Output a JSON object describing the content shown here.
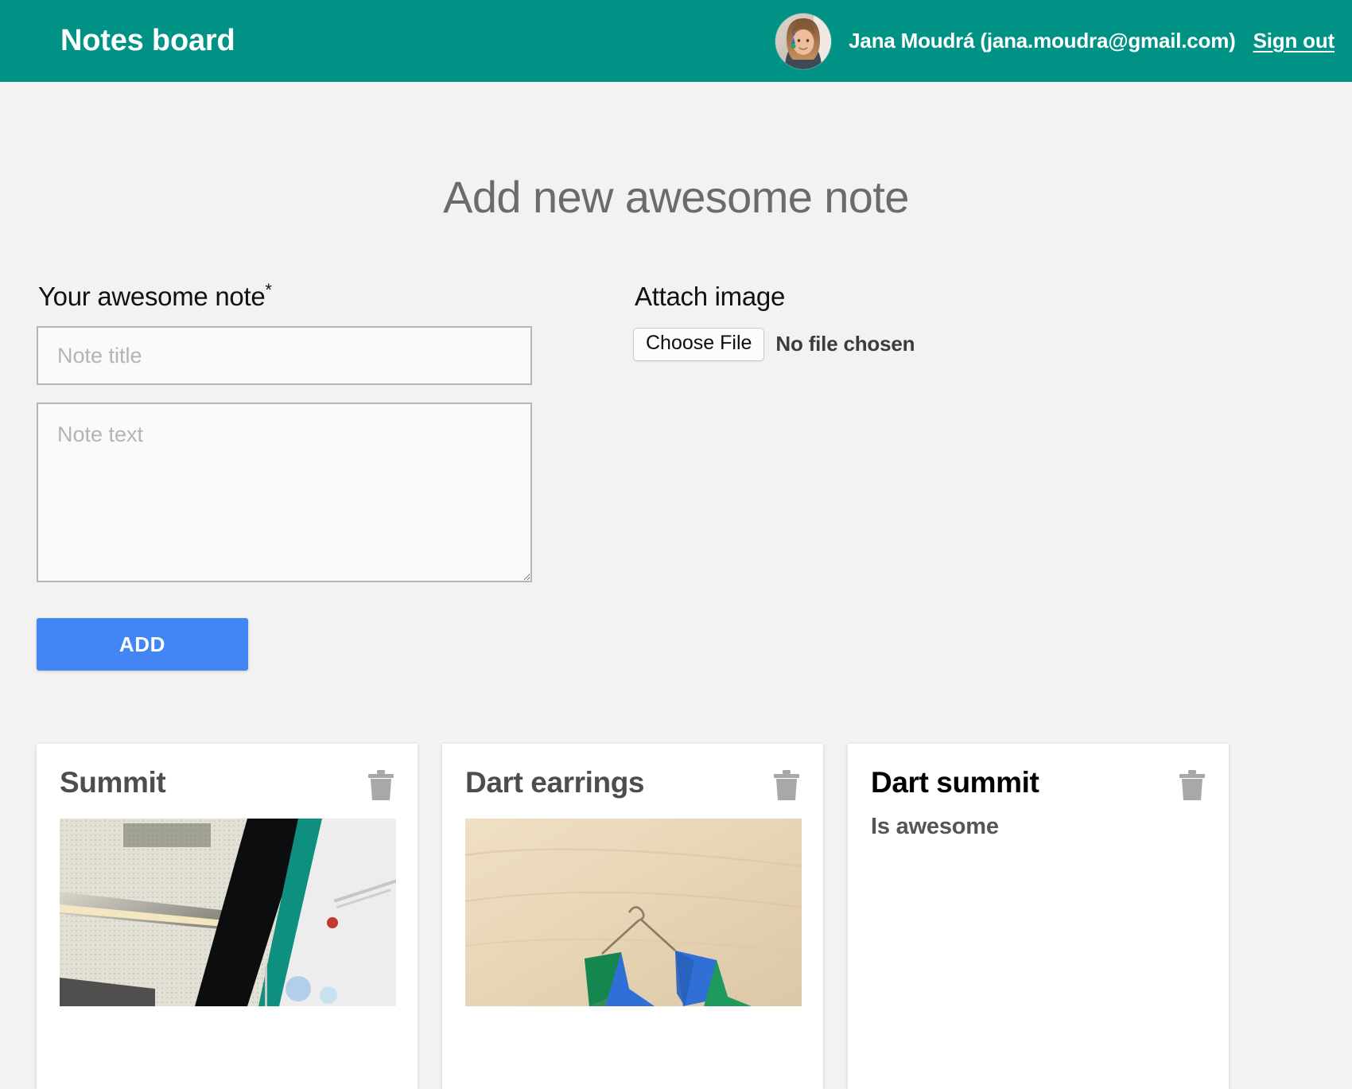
{
  "header": {
    "app_title": "Notes board",
    "user_label": "Jana Moudrá (jana.moudra@gmail.com)",
    "sign_out_label": "Sign out",
    "brand_color": "#009385"
  },
  "main": {
    "page_title": "Add new awesome note",
    "note_label": "Your awesome note",
    "required_marker": "*",
    "title_placeholder": "Note title",
    "title_value": "",
    "text_placeholder": "Note text",
    "text_value": "",
    "add_button_label": "ADD",
    "add_button_color": "#4285f4",
    "attach_label": "Attach image",
    "choose_file_label": "Choose File",
    "file_status": "No file chosen"
  },
  "cards": [
    {
      "title": "Summit",
      "body": "",
      "has_image": true,
      "delete_label": "Delete note"
    },
    {
      "title": "Dart earrings",
      "body": "",
      "has_image": true,
      "delete_label": "Delete note"
    },
    {
      "title": "Dart summit",
      "body": "Is awesome",
      "has_image": false,
      "delete_label": "Delete note"
    }
  ]
}
